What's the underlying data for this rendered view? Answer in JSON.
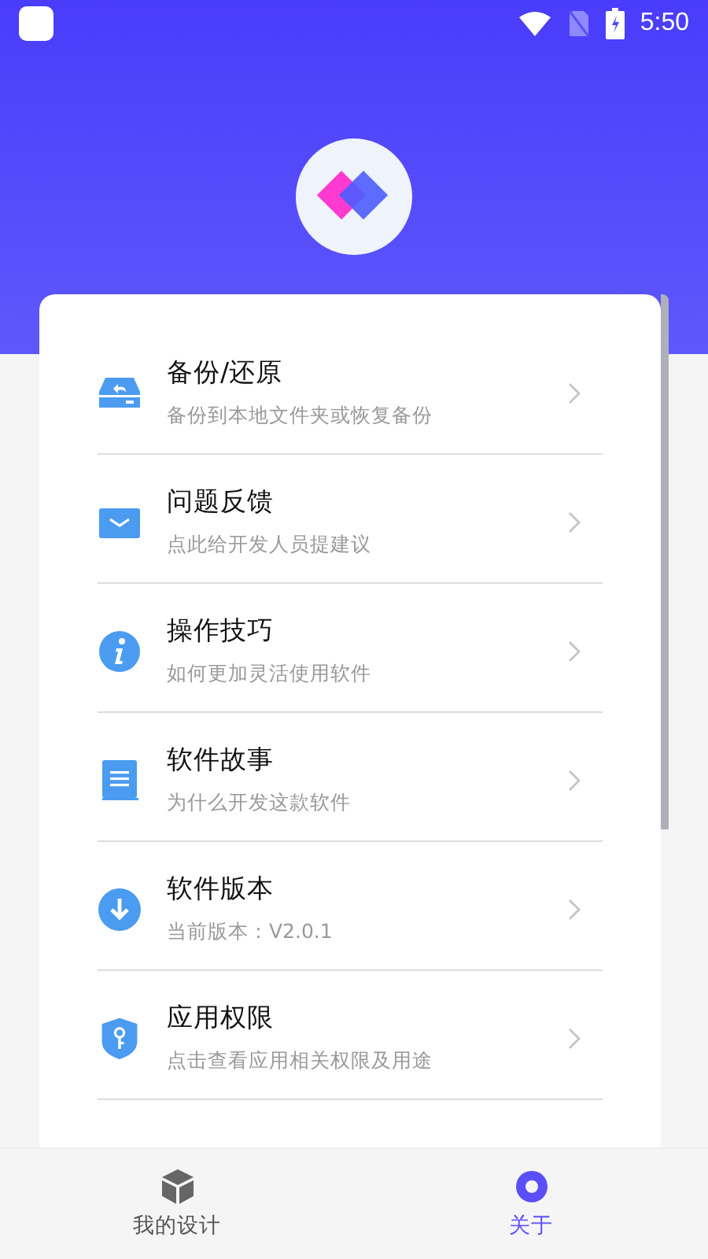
{
  "status_bar": {
    "time": "5:50"
  },
  "menu": [
    {
      "kind": "backup",
      "title": "备份/还原",
      "subtitle": "备份到本地文件夹或恢复备份"
    },
    {
      "kind": "mail",
      "title": "问题反馈",
      "subtitle": "点此给开发人员提建议"
    },
    {
      "kind": "info",
      "title": "操作技巧",
      "subtitle": "如何更加灵活使用软件"
    },
    {
      "kind": "book",
      "title": "软件故事",
      "subtitle": "为什么开发这款软件"
    },
    {
      "kind": "download",
      "title": "软件版本",
      "subtitle": "当前版本：V2.0.1"
    },
    {
      "kind": "shield",
      "title": "应用权限",
      "subtitle": "点击查看应用相关权限及用途"
    }
  ],
  "bottom_nav": [
    {
      "kind": "cube",
      "label": "我的设计",
      "selected": false
    },
    {
      "kind": "circle",
      "label": "关于",
      "selected": true
    }
  ]
}
